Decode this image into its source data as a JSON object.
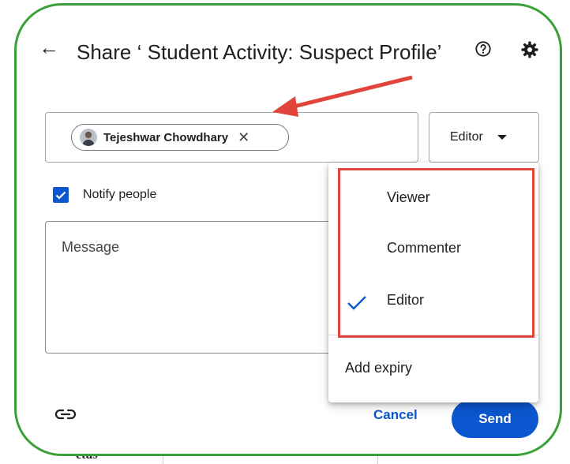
{
  "dialog": {
    "title": "Share ‘ Student Activity: Suspect Profile’",
    "recipient_name": "Tejeshwar Chowdhary",
    "role_label": "Editor",
    "notify_label": "Notify people",
    "notify_checked": true,
    "message_placeholder": "Message",
    "cancel_label": "Cancel",
    "send_label": "Send"
  },
  "role_menu": {
    "items": [
      "Viewer",
      "Commenter",
      "Editor"
    ],
    "selected": "Editor",
    "add_expiry_label": "Add expiry"
  },
  "icons": [
    "back-arrow-icon",
    "help-icon",
    "settings-gear-icon",
    "close-icon",
    "dropdown-caret-icon",
    "checkbox-check-icon",
    "link-icon",
    "checkmark-icon"
  ],
  "colors": {
    "accent": "#0b57d0",
    "annotation_red": "#e0443b",
    "frame_green": "#3aa03a"
  },
  "background_doc": {
    "visible_text": "ctus"
  }
}
